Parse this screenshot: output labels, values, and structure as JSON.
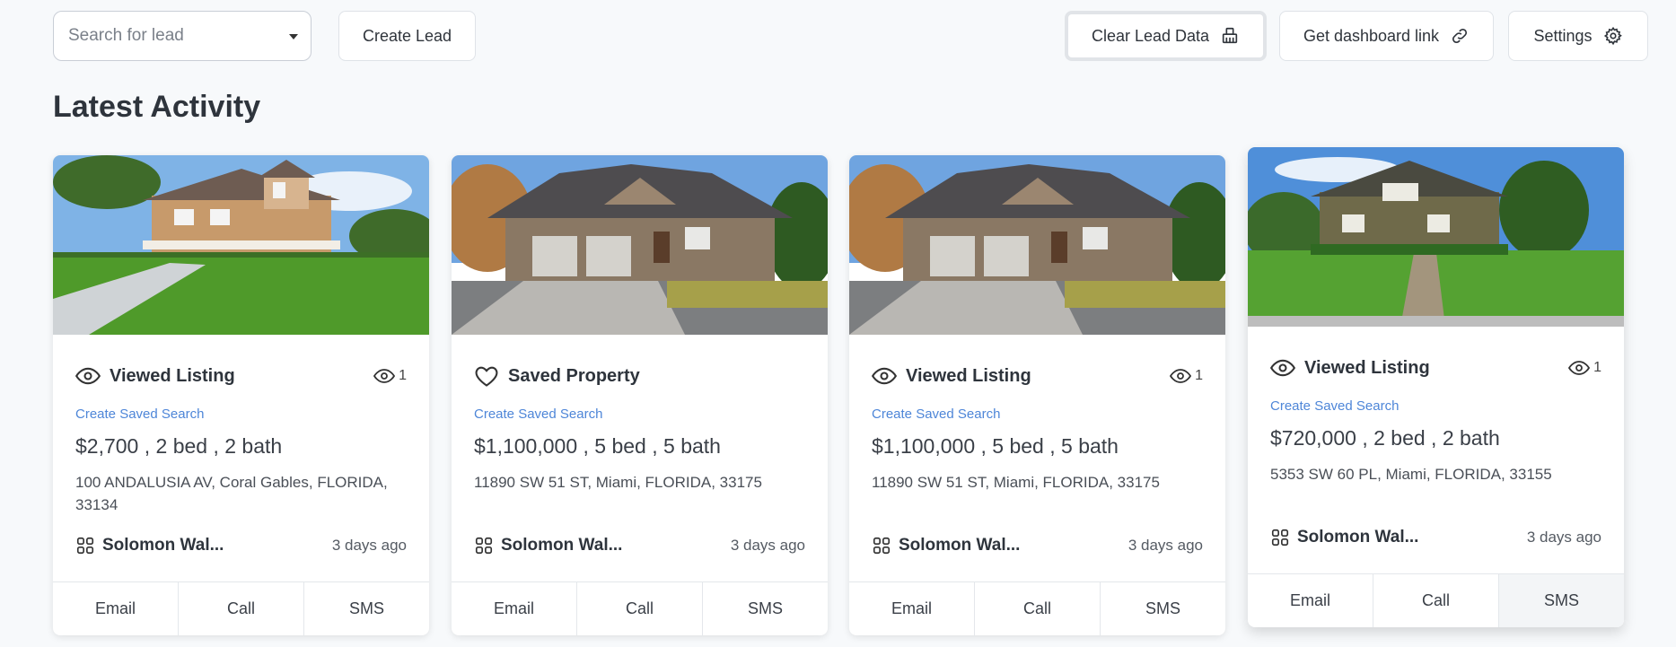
{
  "toolbar": {
    "search_placeholder": "Search for lead",
    "create_lead": "Create Lead",
    "clear_lead_data": "Clear Lead Data",
    "dashboard_link": "Get dashboard link",
    "settings": "Settings"
  },
  "heading": "Latest Activity",
  "cards": [
    {
      "activity": "Viewed Listing",
      "activity_icon": "eye-icon",
      "views": "1",
      "saved_search": "Create Saved Search",
      "price": "$2,700 , 2 bed , 2 bath",
      "address": "100 ANDALUSIA AV, Coral Gables, FLORIDA, 33134",
      "lead": "Solomon Wal...",
      "time": "3 days ago",
      "actions": [
        "Email",
        "Call",
        "SMS"
      ]
    },
    {
      "activity": "Saved Property",
      "activity_icon": "heart-icon",
      "views": "",
      "saved_search": "Create Saved Search",
      "price": "$1,100,000 , 5 bed , 5 bath",
      "address": "11890 SW 51 ST, Miami, FLORIDA, 33175",
      "lead": "Solomon Wal...",
      "time": "3 days ago",
      "actions": [
        "Email",
        "Call",
        "SMS"
      ]
    },
    {
      "activity": "Viewed Listing",
      "activity_icon": "eye-icon",
      "views": "1",
      "saved_search": "Create Saved Search",
      "price": "$1,100,000 , 5 bed , 5 bath",
      "address": "11890 SW 51 ST, Miami, FLORIDA, 33175",
      "lead": "Solomon Wal...",
      "time": "3 days ago",
      "actions": [
        "Email",
        "Call",
        "SMS"
      ]
    },
    {
      "activity": "Viewed Listing",
      "activity_icon": "eye-icon",
      "views": "1",
      "saved_search": "Create Saved Search",
      "price": "$720,000 , 2 bed , 2 bath",
      "address": "5353 SW 60 PL, Miami, FLORIDA, 33155",
      "lead": "Solomon Wal...",
      "time": "3 days ago",
      "actions": [
        "Email",
        "Call",
        "SMS"
      ]
    }
  ],
  "colors": {
    "background": "#f7f9fb",
    "link": "#4e86d8",
    "card": "#ffffff"
  }
}
